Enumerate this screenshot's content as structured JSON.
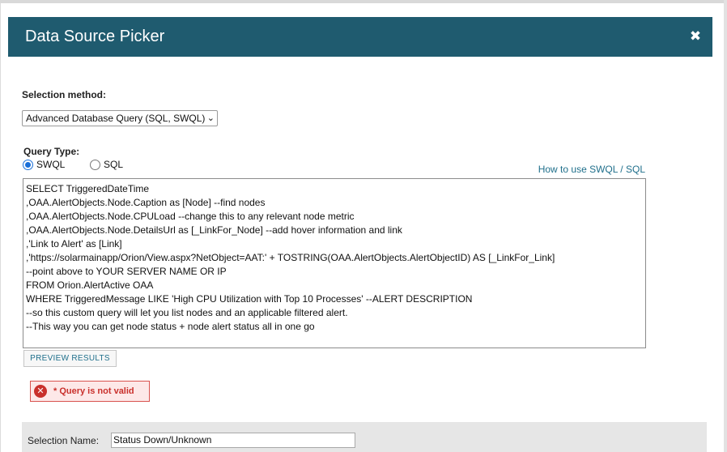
{
  "dialog": {
    "title": "Data Source Picker",
    "close_glyph": "✖"
  },
  "selection_method": {
    "label": "Selection method:",
    "selected": "Advanced Database Query (SQL, SWQL)"
  },
  "query_type": {
    "label": "Query Type:",
    "options": [
      "SWQL",
      "SQL"
    ],
    "selected": "SWQL",
    "help_link": "How to use SWQL / SQL"
  },
  "query": {
    "lines": [
      "SELECT TriggeredDateTime",
      ",OAA.AlertObjects.Node.Caption as [Node] --find nodes",
      ",OAA.AlertObjects.Node.CPULoad --change this to any relevant node metric",
      ",OAA.AlertObjects.Node.DetailsUrl as [_LinkFor_Node] --add hover information and link",
      ",'Link to Alert' as [Link]",
      ",'https://solarmainapp/Orion/View.aspx?NetObject=AAT:' + TOSTRING(OAA.AlertObjects.AlertObjectID) AS [_LinkFor_Link]",
      "--point above to YOUR SERVER NAME OR IP",
      "FROM Orion.AlertActive OAA",
      "WHERE TriggeredMessage LIKE 'High CPU Utilization with Top 10 Processes' --ALERT DESCRIPTION",
      "--so this custom query will let you list nodes and an applicable filtered alert.",
      "--This way you can get node status + node alert status all in one go"
    ]
  },
  "preview_button": "PREVIEW RESULTS",
  "error": {
    "message": "* Query is not valid",
    "icon": "error-x-icon"
  },
  "selection_name": {
    "label": "Selection Name:",
    "value": "Status Down/Unknown"
  },
  "colors": {
    "titlebar": "#1f5b6f",
    "link": "#1f6f8b",
    "error": "#c9302c"
  }
}
